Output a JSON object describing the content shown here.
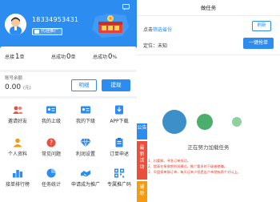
{
  "profile": {
    "phone": "18334953431",
    "agent_tag": "代理推广",
    "promo_icon": "promo-banner-icon",
    "message_icon": "message-icon"
  },
  "stats": [
    {
      "label": "总接",
      "value": "1",
      "unit": "单"
    },
    {
      "label": "总成功",
      "value": "0",
      "unit": "单"
    },
    {
      "label": "总成功",
      "value": "0",
      "unit": "%"
    }
  ],
  "balance": {
    "label": "账号余额",
    "value": "0.00",
    "unit": "(元)",
    "detail_button": "明细",
    "withdraw_button": "提现"
  },
  "menu": [
    {
      "label": "邀请好友",
      "icon": "invite-icon",
      "color": "#e94f3c"
    },
    {
      "label": "我的上级",
      "icon": "id-card-icon",
      "color": "#2d8cf0"
    },
    {
      "label": "我的下级",
      "icon": "id-card-icon",
      "color": "#2d8cf0"
    },
    {
      "label": "APP下载",
      "icon": "download-icon",
      "color": "#2d8cf0"
    },
    {
      "label": "个人资料",
      "icon": "user-icon",
      "color": "#f39c12"
    },
    {
      "label": "常见问题",
      "icon": "question-icon",
      "color": "#e94f3c"
    },
    {
      "label": "利润设置",
      "icon": "diamond-icon",
      "color": "#2d8cf0"
    },
    {
      "label": "订单申述",
      "icon": "clipboard-icon",
      "color": "#2d8cf0"
    },
    {
      "label": "接单排行榜",
      "icon": "ranking-icon",
      "color": "#2d8cf0"
    },
    {
      "label": "任务统计",
      "icon": "chart-icon",
      "color": "#2d8cf0"
    },
    {
      "label": "申请成为推广",
      "icon": "handshake-icon",
      "color": "#2d8cf0"
    },
    {
      "label": "专属推广码",
      "icon": "qrcode-icon",
      "color": "#2d8cf0"
    }
  ],
  "task": {
    "title": "做任务",
    "filter_prefix": "点击",
    "filter_link": "筛选省份",
    "refresh_button": "刷新",
    "location_label": "定位：未知",
    "grab_button": "一键抢单",
    "loading_text": "正在努力加载任务",
    "notes": [
      "1、抖要解，寻急订单成功。",
      "2、提高在接收期利润模式，推广要多的下级被使赚。",
      "3、早盘接单接订单，每天订单少但是出个单就有两个对以上。"
    ],
    "side_tabs": [
      {
        "text": "公告",
        "color": "#2d8cf0"
      },
      {
        "text": "最新活动",
        "color": "#e94f3c"
      },
      {
        "text": "辅助",
        "color": "#f39c12"
      }
    ]
  },
  "colors": {
    "brand": "#2d8cf0",
    "accent_red": "#e94f3c",
    "loader_big": "#3d8fc9",
    "loader_mid": "#4cae6c",
    "loader_small": "#8fd19e"
  }
}
